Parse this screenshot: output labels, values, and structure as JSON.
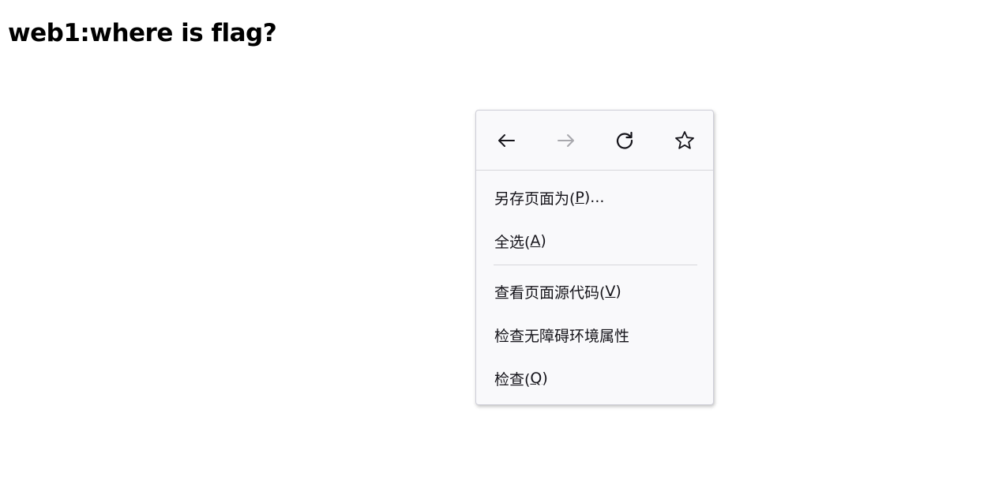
{
  "page": {
    "heading": "web1:where is flag?"
  },
  "context_menu": {
    "nav": {
      "back_icon": "arrow-left-icon",
      "forward_icon": "arrow-right-icon",
      "reload_icon": "reload-icon",
      "bookmark_icon": "star-icon",
      "forward_disabled": true
    },
    "items": [
      {
        "prefix": "另存页面为(",
        "accesskey": "P",
        "suffix": ")..."
      },
      {
        "prefix": "全选(",
        "accesskey": "A",
        "suffix": ")"
      },
      {
        "prefix": "查看页面源代码(",
        "accesskey": "V",
        "suffix": ")"
      },
      {
        "prefix": "检查无障碍环境属性",
        "accesskey": "",
        "suffix": ""
      },
      {
        "prefix": "检查(",
        "accesskey": "Q",
        "suffix": ")"
      }
    ]
  },
  "colors": {
    "menu_background": "#f9f9fb",
    "menu_text": "#15141a",
    "disabled_icon": "#a8a8ad",
    "separator": "#d7d7db"
  }
}
